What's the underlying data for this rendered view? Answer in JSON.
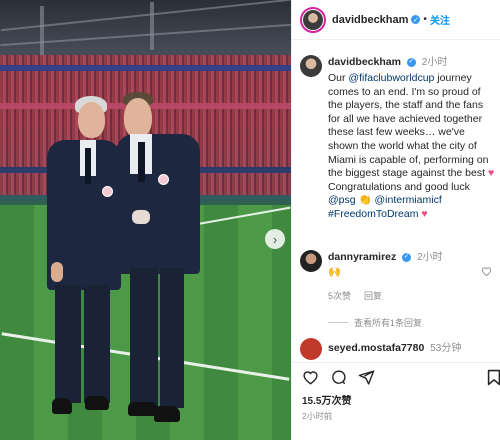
{
  "post": {
    "author": "davidbeckham",
    "follow_label": "关注",
    "separator": "•"
  },
  "caption": {
    "author": "davidbeckham",
    "time": "2小时",
    "text_part1": "Our ",
    "mention1": "@fifaclubworldcup",
    "text_part2": " journey comes to an end. I'm so proud of the players, the staff and the fans for all we have achieved together these last few weeks… we've shown the world what the city of Miami is capable of, performing on the biggest stage against the best ",
    "heart1": "♥",
    "text_part3": " Congratulations and good luck ",
    "mention2": "@psg",
    "clap": "👏",
    "mention3": "@intermiamicf",
    "hashtag": "#FreedomToDream",
    "heart2": "♥"
  },
  "comments": [
    {
      "author": "dannyramirez",
      "time": "2小时",
      "text": "🙌",
      "likes": "5次赞",
      "reply": "回复",
      "view_replies": "查看所有1条回复"
    },
    {
      "author": "seyed.mostafa7780",
      "time": "53分钟"
    }
  ],
  "footer": {
    "likes": "15.5万次赞",
    "posted_ago": "2小时前"
  },
  "icons": {
    "heart": "heart-icon",
    "comment": "comment-icon",
    "share": "share-icon",
    "save": "bookmark-icon",
    "next": "chevron-right-icon"
  },
  "colors": {
    "link": "#00376b",
    "follow": "#0095f6",
    "verified": "#3897f0",
    "heart": "#ed4b82"
  }
}
